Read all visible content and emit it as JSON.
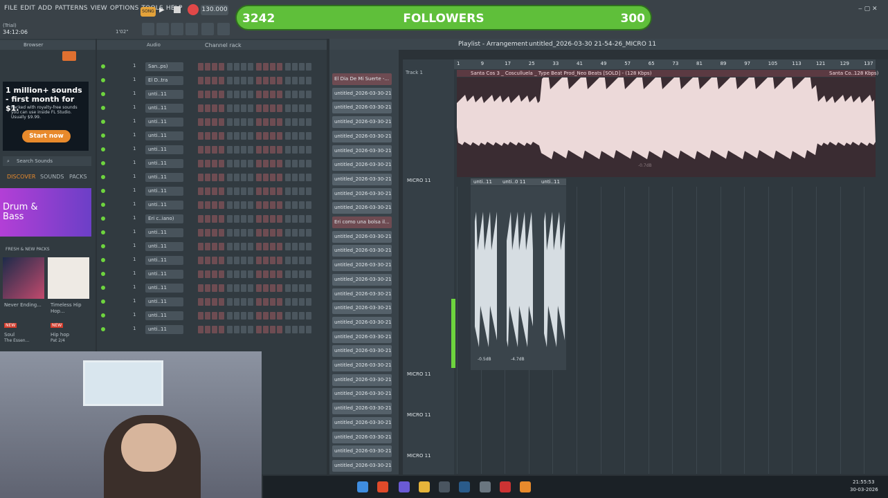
{
  "menu_items": [
    "FILE",
    "EDIT",
    "ADD",
    "PATTERNS",
    "VIEW",
    "OPTIONS",
    "TOOLS",
    "HELP"
  ],
  "status": {
    "trial": "(Trial)",
    "time": "34:12:06",
    "small_counter": "1'02\""
  },
  "transport": {
    "song_label": "SONG",
    "tempo": "130.000"
  },
  "followers": {
    "current": "3242",
    "label": "FOLLOWERS",
    "goal": "300"
  },
  "browser": {
    "title": "Browser",
    "ad_title": "1 million+ sounds - first month for $1.",
    "ad_body": "Packed with royalty-free sounds you can use inside FL Studio. Usually $9.99.",
    "start_button": "Start now",
    "search_placeholder": "Search Sounds",
    "tabs": [
      "DISCOVER",
      "SOUNDS",
      "PACKS"
    ],
    "banner": "Drum & Bass",
    "packs_header": "FRESH & NEW PACKS",
    "pack1": {
      "name": "Never Ending...",
      "badge": "NEW",
      "genre": "Soul",
      "author": "The Essen..."
    },
    "pack2": {
      "name": "Timeless Hip Hop...",
      "badge": "NEW",
      "genre": "Hip hop",
      "author": "Pat 2/4"
    }
  },
  "channel_rack": {
    "title": "Channel rack",
    "audio_label": "Audio",
    "channels": [
      "San..ps)",
      "El D..tra",
      "unti..11",
      "unti..11",
      "unti..11",
      "unti..11",
      "unti..11",
      "unti..11",
      "unti..11",
      "unti..11",
      "unti..11",
      "Eri c..iano)",
      "unti..11",
      "unti..11",
      "unti..11",
      "unti..11",
      "unti..11",
      "unti..11",
      "unti..11",
      "unti..11"
    ]
  },
  "playlist": {
    "title": "Playlist - Arrangement",
    "project": "untitled_2026-03-30 21-54-26_MICRO 11",
    "patterns": [
      "El Dia De Mi Suerte -...",
      "untitled_2026-03-30-21-",
      "untitled_2026-03-30-21-",
      "untitled_2026-03-30-21-",
      "untitled_2026-03-30-21-",
      "untitled_2026-03-30-21-",
      "untitled_2026-03-30-21-",
      "untitled_2026-03-30-21-",
      "untitled_2026-03-30-21-",
      "untitled_2026-03-30-21-",
      "Eri como una bolsa il...",
      "untitled_2026-03-30-21-",
      "untitled_2026-03-30-21-",
      "untitled_2026-03-30-21-",
      "untitled_2026-03-30-21-",
      "untitled_2026-03-30-21-",
      "untitled_2026-03-30-21-",
      "untitled_2026-03-30-21-",
      "untitled_2026-03-30-21-",
      "untitled_2026-03-30-21-",
      "untitled_2026-03-30-21-",
      "untitled_2026-03-30-21-",
      "untitled_2026-03-30-21-",
      "untitled_2026-03-30-21-",
      "untitled_2026-03-30-21-",
      "untitled_2026-03-30-21-",
      "untitled_2026-03-30-21-",
      "untitled_2026-03-30-21-"
    ],
    "ruler": [
      "1",
      "9",
      "17",
      "25",
      "33",
      "41",
      "49",
      "57",
      "65",
      "73",
      "81",
      "89",
      "97",
      "105",
      "113",
      "121",
      "129",
      "137"
    ],
    "tracks": [
      "Track 1",
      "MICRO 11",
      "MICRO 11",
      "MICRO 11",
      "MICRO 11"
    ],
    "main_clip": "Santa Cos 3 _ Cosculluela _ Type Beat Prod_Neo Beats [SOLD] - (128 Kbps)",
    "main_clip_tail": "Santa Co..128 Kbps)",
    "main_gain": "-0.7dB",
    "clips": [
      "unti..11",
      "unti..0 11",
      "unti..11"
    ],
    "gains": [
      "-0.5dB",
      "-4.7dB"
    ]
  },
  "clock": {
    "time": "21:55:53",
    "date": "30-03-2026"
  }
}
